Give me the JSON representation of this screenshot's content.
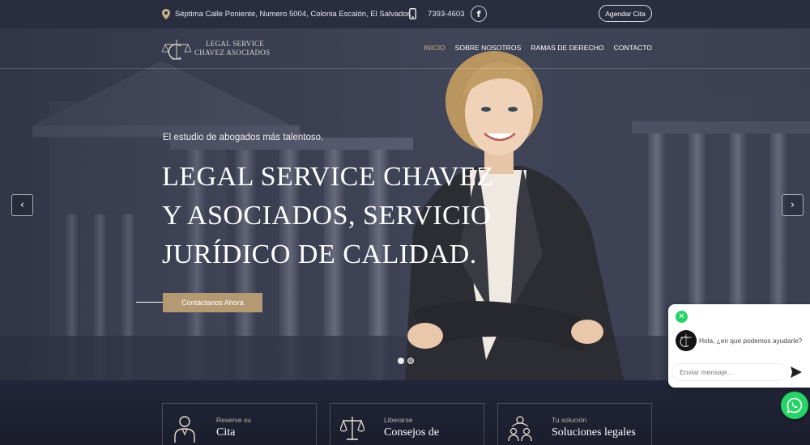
{
  "topbar": {
    "address": "Séptima Calle Poniente, Numero 5004, Colonia Escalón, El Salvador.",
    "phone": "7393-4603",
    "facebook_icon": "facebook-icon",
    "cta_label": "Agendar Cita"
  },
  "header": {
    "logo_line1": "LEGAL SERVICE",
    "logo_line2": "CHAVEZ ASOCIADOS",
    "nav": [
      "INICIO",
      "SOBRE NOSOTROS",
      "RAMAS DE DERECHO",
      "CONTACTO"
    ],
    "active_nav": "INICIO"
  },
  "hero": {
    "kicker": "El estudio de abogados más talentoso.",
    "headline": "LEGAL SERVICE CHAVEZ Y ASOCIADOS, SERVICIO JURÍDICO DE CALIDAD.",
    "cta_label": "Contáctanos Ahora",
    "slides_total": 2,
    "slide_active": 1
  },
  "services": [
    {
      "subtitle": "Reserve su",
      "title": "Cita",
      "icon": "lawyer-icon"
    },
    {
      "subtitle": "Liberarse",
      "title": "Consejos de",
      "icon": "scales-icon"
    },
    {
      "subtitle": "Tu solución",
      "title": "Soluciones legales",
      "icon": "team-icon"
    }
  ],
  "chat": {
    "message": "Hola, ¿en que podemos ayudarle?",
    "input_placeholder": "Enviar mensaje...",
    "accent": "#25d366"
  },
  "colors": {
    "gold": "#b49a72",
    "nav_active": "#c7b48d",
    "topbar_bg": "#2a2d40"
  }
}
